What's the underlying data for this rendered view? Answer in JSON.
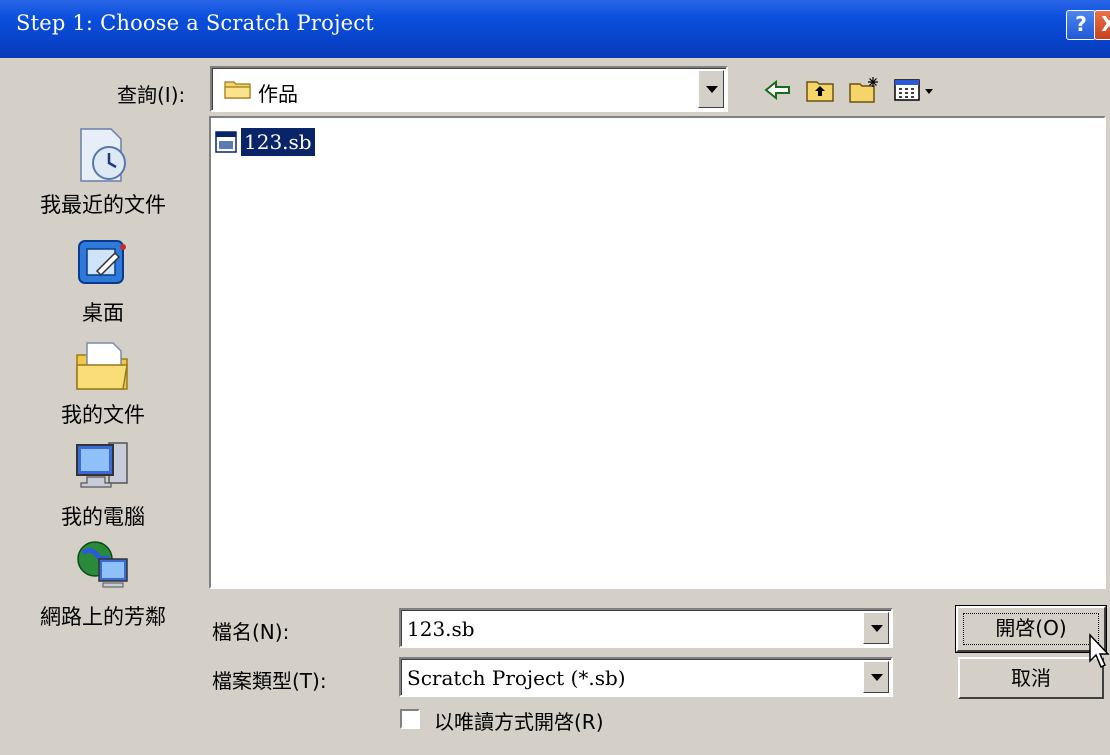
{
  "window": {
    "title": "Step 1: Choose a Scratch Project",
    "help_glyph": "?",
    "close_glyph": "X"
  },
  "lookin": {
    "label": "查詢(I):",
    "value": "作品"
  },
  "places": [
    {
      "label": "我最近的文件",
      "icon": "recent-documents-icon"
    },
    {
      "label": "桌面",
      "icon": "desktop-icon"
    },
    {
      "label": "我的文件",
      "icon": "my-documents-icon"
    },
    {
      "label": "我的電腦",
      "icon": "my-computer-icon"
    },
    {
      "label": "網路上的芳鄰",
      "icon": "network-places-icon"
    }
  ],
  "files": [
    {
      "name": "123.sb",
      "selected": true
    }
  ],
  "filename": {
    "label": "檔名(N):",
    "value": "123.sb"
  },
  "filetype": {
    "label": "檔案類型(T):",
    "value": "Scratch Project (*.sb)"
  },
  "readonly": {
    "label": "以唯讀方式開啓(R)",
    "checked": false
  },
  "buttons": {
    "open": "開啓(O)",
    "cancel": "取消"
  },
  "colors": {
    "titlebar": "#0b4fdc",
    "dialog_bg": "#d4d0c8",
    "selection": "#0a246a"
  }
}
